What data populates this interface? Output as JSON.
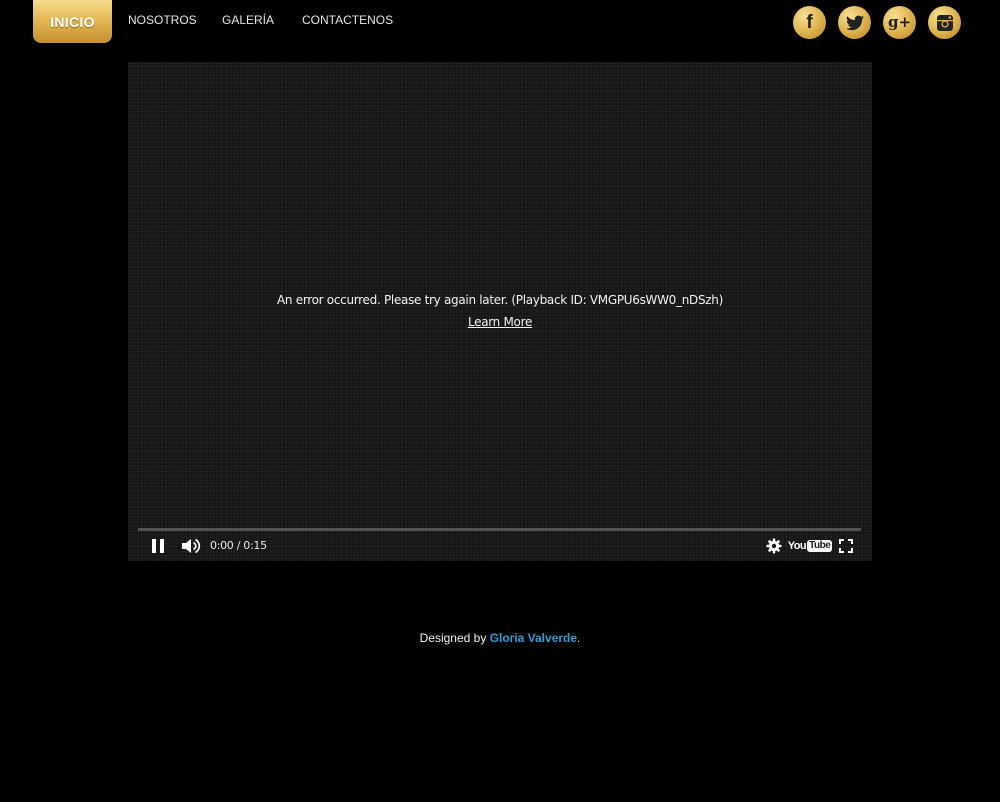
{
  "nav": {
    "active": "INICIO",
    "items": [
      "NOSOTROS",
      "GALERÍA",
      "CONTACTENOS"
    ]
  },
  "social": [
    {
      "icon": "facebook-icon",
      "glyph": "f"
    },
    {
      "icon": "twitter-icon"
    },
    {
      "icon": "google-plus-icon",
      "glyph": "g+"
    },
    {
      "icon": "instagram-icon"
    }
  ],
  "video": {
    "error_message": "An error occurred. Please try again later. (Playback ID: VMGPU6sWW0_nDSzh)",
    "learn_more": "Learn More",
    "time": "0:00 / 0:15",
    "progress": 0,
    "yt_you": "You",
    "yt_tube": "Tube"
  },
  "footer": {
    "prefix": "Designed by ",
    "credit": "Gloria Valverde",
    "suffix": "."
  },
  "colors": {
    "gold": "#e2b954",
    "credit": "#2a9fd6",
    "background": "#000000"
  }
}
